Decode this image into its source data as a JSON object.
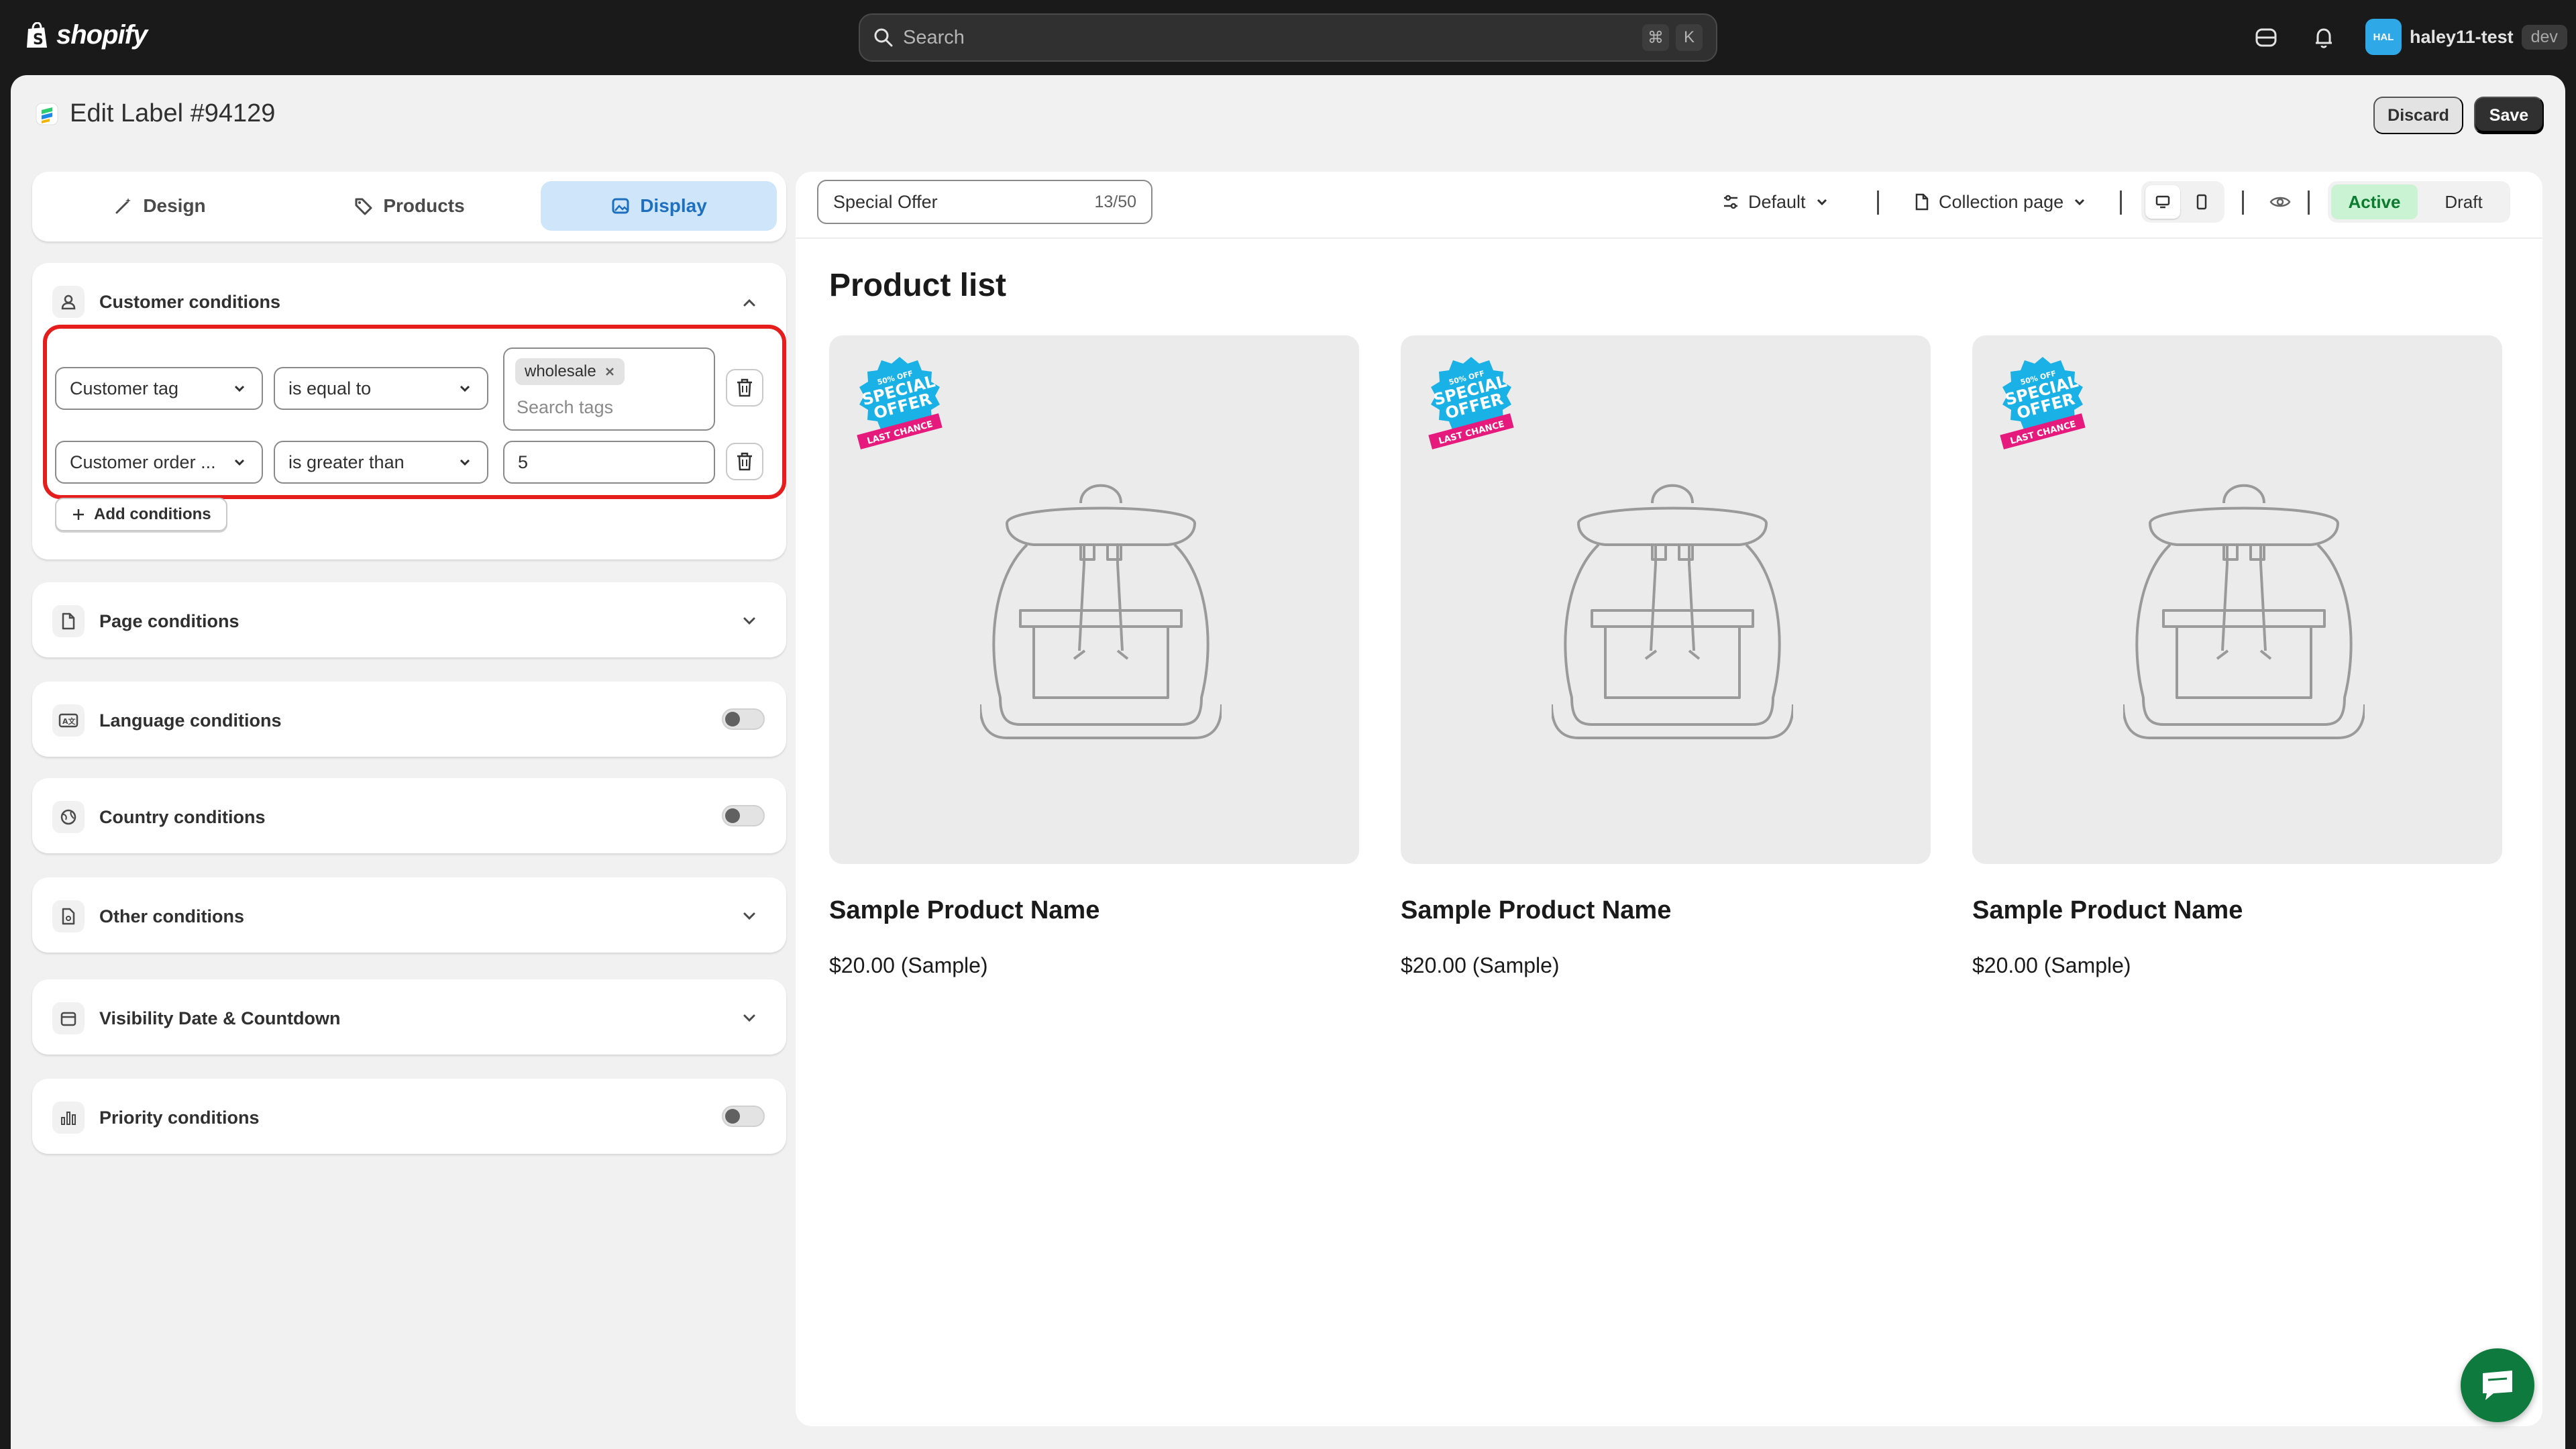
{
  "topbar": {
    "logo_text": "shopify",
    "search_placeholder": "Search",
    "kbd_cmd": "⌘",
    "kbd_k": "K",
    "user_initials": "HAL",
    "user_name": "haley11-test",
    "user_badge": "dev"
  },
  "page": {
    "title": "Edit Label #94129",
    "discard_label": "Discard",
    "save_label": "Save"
  },
  "tabs": [
    {
      "label": "Design",
      "icon": "wand-icon"
    },
    {
      "label": "Products",
      "icon": "tag-icon"
    },
    {
      "label": "Display",
      "icon": "image-icon"
    }
  ],
  "customer_conditions": {
    "title": "Customer conditions",
    "rows": [
      {
        "field": "Customer tag",
        "operator": "is equal to",
        "tag": "wholesale",
        "tag_placeholder": "Search tags"
      },
      {
        "field": "Customer order ...",
        "operator": "is greater than",
        "value": "5"
      }
    ],
    "add_label": "Add conditions"
  },
  "sections": {
    "page": "Page conditions",
    "language": "Language conditions",
    "country": "Country conditions",
    "other": "Other conditions",
    "visibility": "Visibility Date & Countdown",
    "priority": "Priority conditions"
  },
  "preview": {
    "label_name": "Special Offer",
    "char_count": "13/50",
    "template": "Default",
    "page_type": "Collection page",
    "status_active": "Active",
    "status_draft": "Draft",
    "list_title": "Product list",
    "badge": {
      "top": "50% OFF",
      "line1": "SPECIAL",
      "line2": "OFFER",
      "ribbon": "LAST CHANCE"
    },
    "products": [
      {
        "name": "Sample Product Name",
        "price": "$20.00 (Sample)"
      },
      {
        "name": "Sample Product Name",
        "price": "$20.00 (Sample)"
      },
      {
        "name": "Sample Product Name",
        "price": "$20.00 (Sample)"
      }
    ]
  },
  "colors": {
    "accent_blue": "#cfe6fa",
    "highlight_red": "#e51d1d",
    "active_green": "#c9f3d2",
    "chat_green": "#0f7a3e"
  }
}
